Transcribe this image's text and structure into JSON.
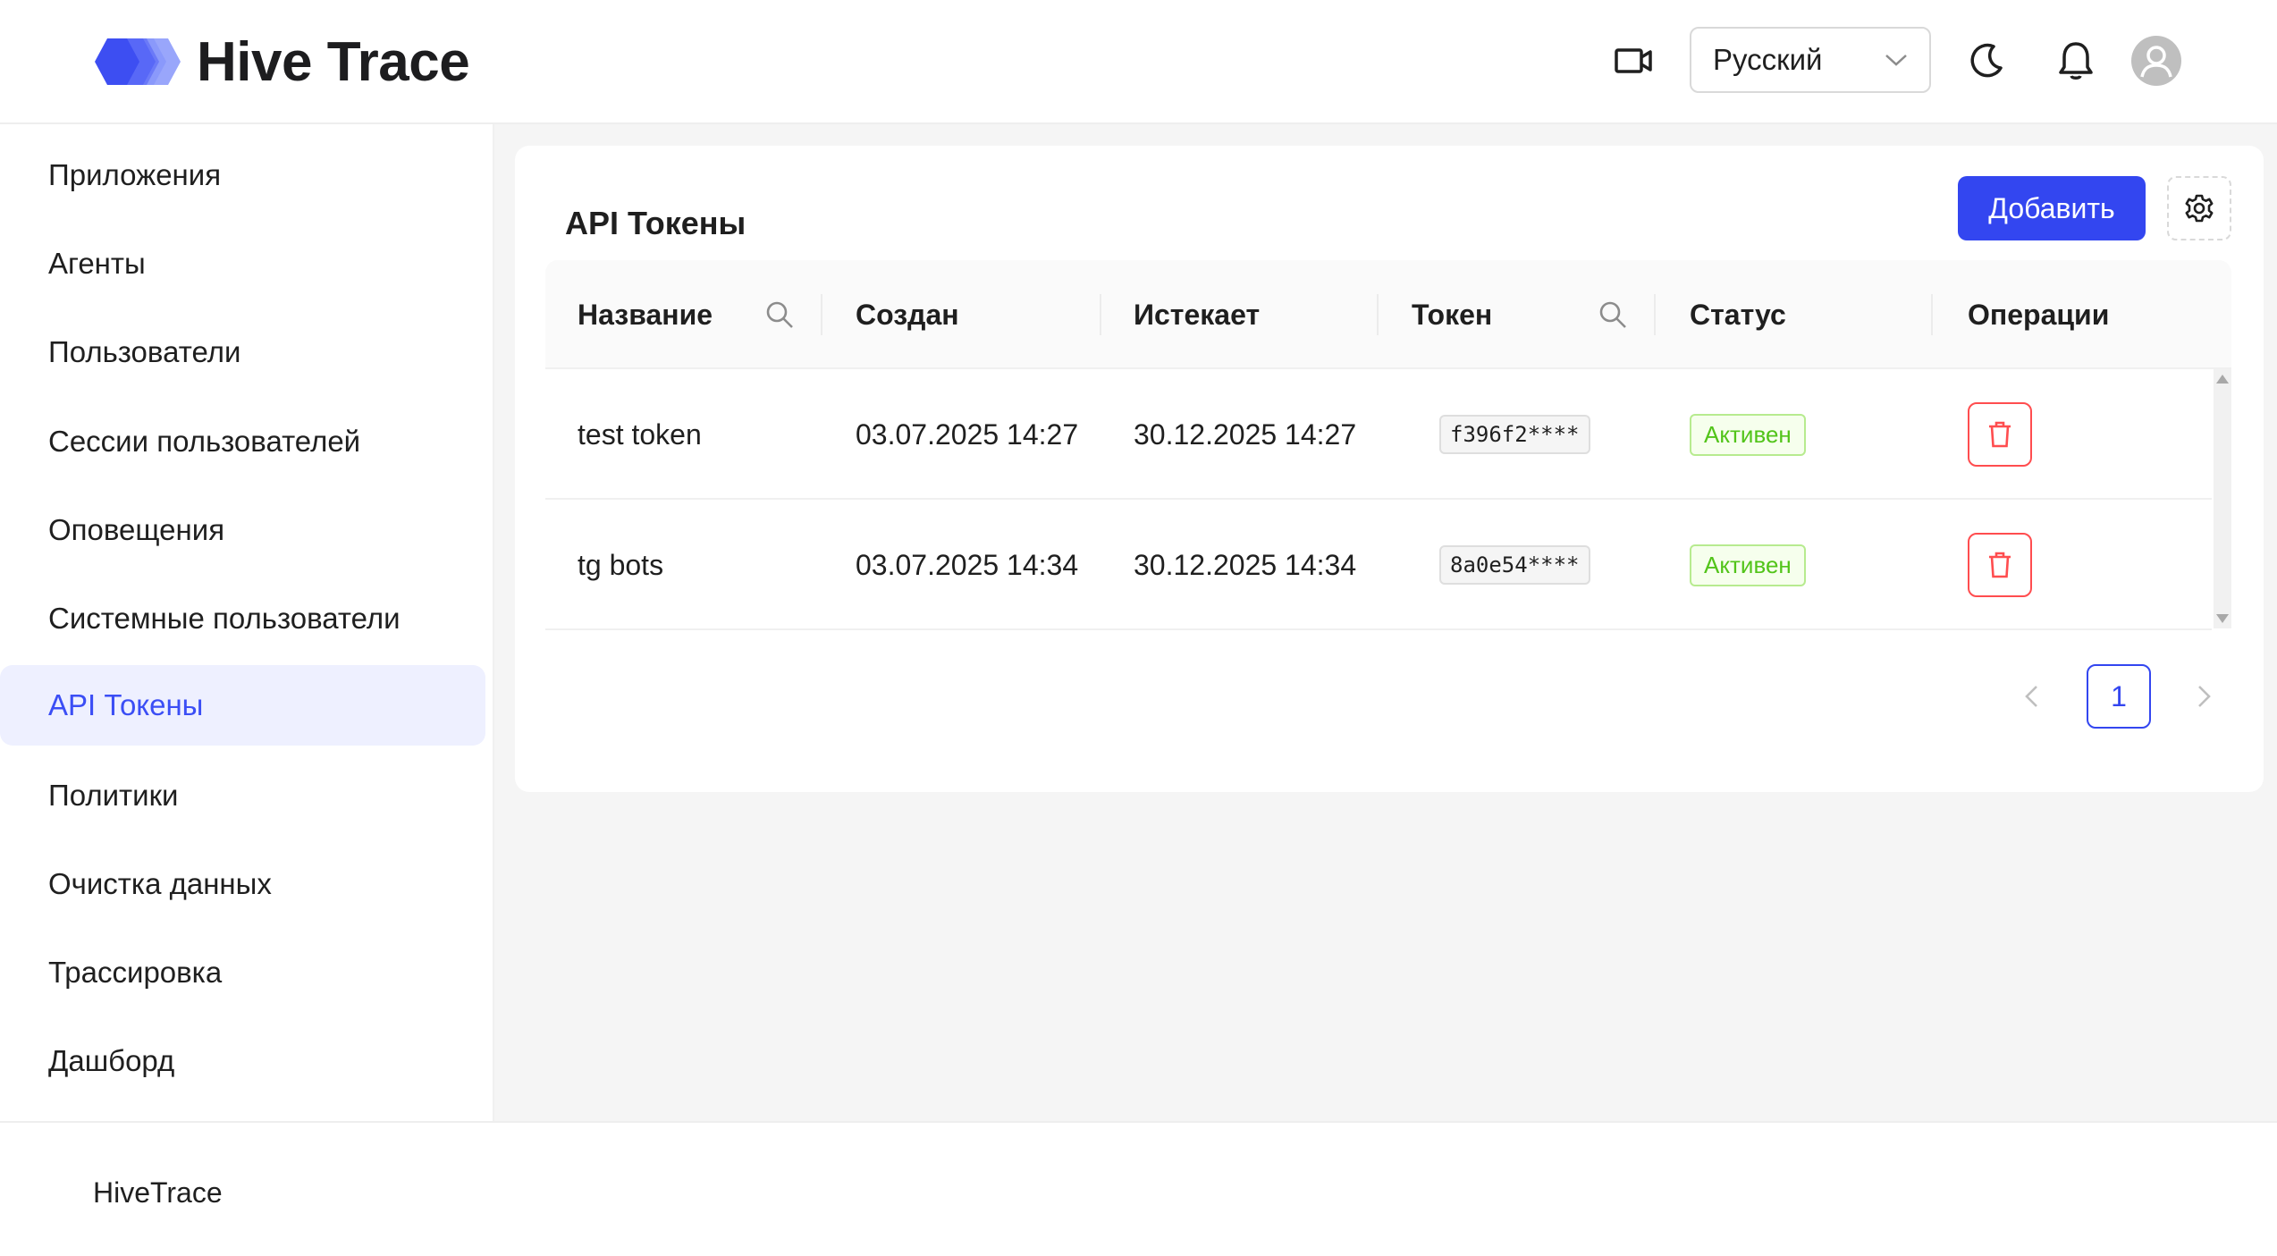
{
  "header": {
    "app_name": "Hive Trace",
    "language": "Русский",
    "icons": [
      "video-icon",
      "chevron-down-icon",
      "moon-icon",
      "bell-icon",
      "user-avatar-icon"
    ]
  },
  "sidebar": {
    "items": [
      {
        "label": "Приложения"
      },
      {
        "label": "Агенты"
      },
      {
        "label": "Пользователи"
      },
      {
        "label": "Сессии пользователей"
      },
      {
        "label": "Оповещения"
      },
      {
        "label": "Системные пользователи"
      },
      {
        "label": "API Токены",
        "active": true
      },
      {
        "label": "Политики"
      },
      {
        "label": "Очистка данных"
      },
      {
        "label": "Трассировка"
      },
      {
        "label": "Дашборд"
      }
    ]
  },
  "main": {
    "title": "API Токены",
    "add_button": "Добавить",
    "table": {
      "columns": [
        "Название",
        "Создан",
        "Истекает",
        "Токен",
        "Статус",
        "Операции"
      ],
      "rows": [
        {
          "name": "test token",
          "created": "03.07.2025 14:27",
          "expires": "30.12.2025 14:27",
          "token": "f396f2****",
          "status": "Активен"
        },
        {
          "name": "tg bots",
          "created": "03.07.2025 14:34",
          "expires": "30.12.2025 14:34",
          "token": "8a0e54****",
          "status": "Активен"
        }
      ]
    },
    "pagination": {
      "current_page": "1"
    }
  },
  "footer": {
    "text": "HiveTrace"
  },
  "colors": {
    "primary": "#3346f0",
    "active_nav_bg": "#eef0ff",
    "status_green": "#52c41a",
    "danger": "#ff4d4f"
  }
}
